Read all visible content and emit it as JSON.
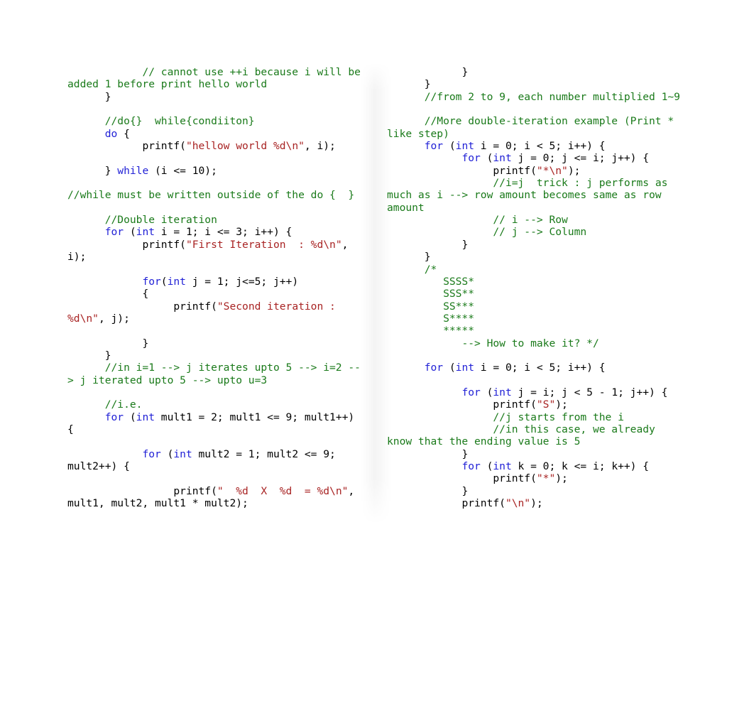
{
  "document": {
    "type": "code-listing",
    "language": "C",
    "layout": "two-column",
    "background_color": "#ffffff",
    "colors": {
      "comment": "#1a7a1a",
      "keyword": "#2121d6",
      "string": "#a82323",
      "plain": "#000000"
    }
  },
  "columns": {
    "left": {
      "lines": [
        [
          {
            "t": "comment",
            "s": "            // cannot use ++i because i will be added 1 before print hello world"
          }
        ],
        [
          {
            "t": "plain",
            "s": "      }"
          }
        ],
        [
          {
            "t": "plain",
            "s": ""
          }
        ],
        [
          {
            "t": "comment",
            "s": "      //do{}  while{condiiton}"
          }
        ],
        [
          {
            "t": "plain",
            "s": "      "
          },
          {
            "t": "keyword",
            "s": "do"
          },
          {
            "t": "plain",
            "s": " {"
          }
        ],
        [
          {
            "t": "plain",
            "s": "            printf("
          },
          {
            "t": "string",
            "s": "\"hellow world %d\\n\""
          },
          {
            "t": "plain",
            "s": ", i);"
          }
        ],
        [
          {
            "t": "plain",
            "s": ""
          }
        ],
        [
          {
            "t": "plain",
            "s": "      } "
          },
          {
            "t": "keyword",
            "s": "while"
          },
          {
            "t": "plain",
            "s": " (i <= 10);"
          }
        ],
        [
          {
            "t": "plain",
            "s": ""
          }
        ],
        [
          {
            "t": "comment",
            "s": "//while must be written outside of the do {  }"
          }
        ],
        [
          {
            "t": "plain",
            "s": ""
          }
        ],
        [
          {
            "t": "comment",
            "s": "      //Double iteration"
          }
        ],
        [
          {
            "t": "plain",
            "s": "      "
          },
          {
            "t": "keyword",
            "s": "for"
          },
          {
            "t": "plain",
            "s": " ("
          },
          {
            "t": "keyword",
            "s": "int"
          },
          {
            "t": "plain",
            "s": " i = 1; i <= 3; i++) {"
          }
        ],
        [
          {
            "t": "plain",
            "s": "            printf("
          },
          {
            "t": "string",
            "s": "\"First Iteration  : %d\\n\""
          },
          {
            "t": "plain",
            "s": ", i);"
          }
        ],
        [
          {
            "t": "plain",
            "s": ""
          }
        ],
        [
          {
            "t": "plain",
            "s": "            "
          },
          {
            "t": "keyword",
            "s": "for"
          },
          {
            "t": "plain",
            "s": "("
          },
          {
            "t": "keyword",
            "s": "int"
          },
          {
            "t": "plain",
            "s": " j = 1; j<=5; j++)"
          }
        ],
        [
          {
            "t": "plain",
            "s": "            {"
          }
        ],
        [
          {
            "t": "plain",
            "s": "                 printf("
          },
          {
            "t": "string",
            "s": "\"Second iteration : %d\\n\""
          },
          {
            "t": "plain",
            "s": ", j);"
          }
        ],
        [
          {
            "t": "plain",
            "s": ""
          }
        ],
        [
          {
            "t": "plain",
            "s": "            }"
          }
        ],
        [
          {
            "t": "plain",
            "s": "      }"
          }
        ],
        [
          {
            "t": "comment",
            "s": "      //in i=1 --> j iterates upto 5 --> i=2 --> j iterated upto 5 --> upto u=3"
          }
        ],
        [
          {
            "t": "plain",
            "s": ""
          }
        ],
        [
          {
            "t": "comment",
            "s": "      //i.e."
          }
        ],
        [
          {
            "t": "plain",
            "s": "      "
          },
          {
            "t": "keyword",
            "s": "for"
          },
          {
            "t": "plain",
            "s": " ("
          },
          {
            "t": "keyword",
            "s": "int"
          },
          {
            "t": "plain",
            "s": " mult1 = 2; mult1 <= 9; mult1++) {"
          }
        ],
        [
          {
            "t": "plain",
            "s": ""
          }
        ],
        [
          {
            "t": "plain",
            "s": "            "
          },
          {
            "t": "keyword",
            "s": "for"
          },
          {
            "t": "plain",
            "s": " ("
          },
          {
            "t": "keyword",
            "s": "int"
          },
          {
            "t": "plain",
            "s": " mult2 = 1; mult2 <= 9; mult2++) {"
          }
        ],
        [
          {
            "t": "plain",
            "s": ""
          }
        ],
        [
          {
            "t": "plain",
            "s": "                 printf("
          },
          {
            "t": "string",
            "s": "\"  %d  X  %d  = %d\\n\""
          },
          {
            "t": "plain",
            "s": ", mult1, mult2, mult1 * mult2);"
          }
        ]
      ]
    },
    "right": {
      "lines": [
        [
          {
            "t": "plain",
            "s": "            }"
          }
        ],
        [
          {
            "t": "plain",
            "s": "      }"
          }
        ],
        [
          {
            "t": "comment",
            "s": "      //from 2 to 9, each number multiplied 1~9"
          }
        ],
        [
          {
            "t": "plain",
            "s": ""
          }
        ],
        [
          {
            "t": "comment",
            "s": "      //More double-iteration example (Print * like step)"
          }
        ],
        [
          {
            "t": "plain",
            "s": "      "
          },
          {
            "t": "keyword",
            "s": "for"
          },
          {
            "t": "plain",
            "s": " ("
          },
          {
            "t": "keyword",
            "s": "int"
          },
          {
            "t": "plain",
            "s": " i = 0; i < 5; i++) {"
          }
        ],
        [
          {
            "t": "plain",
            "s": "            "
          },
          {
            "t": "keyword",
            "s": "for"
          },
          {
            "t": "plain",
            "s": " ("
          },
          {
            "t": "keyword",
            "s": "int"
          },
          {
            "t": "plain",
            "s": " j = 0; j <= i; j++) {"
          }
        ],
        [
          {
            "t": "plain",
            "s": "                 printf("
          },
          {
            "t": "string",
            "s": "\"*\\n\""
          },
          {
            "t": "plain",
            "s": ");"
          }
        ],
        [
          {
            "t": "comment",
            "s": "                 //i=j  trick : j performs as much as i --> row amount becomes same as row amount"
          }
        ],
        [
          {
            "t": "comment",
            "s": "                 // i --> Row"
          }
        ],
        [
          {
            "t": "comment",
            "s": "                 // j --> Column"
          }
        ],
        [
          {
            "t": "plain",
            "s": "            }"
          }
        ],
        [
          {
            "t": "plain",
            "s": "      }"
          }
        ],
        [
          {
            "t": "comment",
            "s": "      /*"
          }
        ],
        [
          {
            "t": "comment",
            "s": "         SSSS*"
          }
        ],
        [
          {
            "t": "comment",
            "s": "         SSS**"
          }
        ],
        [
          {
            "t": "comment",
            "s": "         SS***"
          }
        ],
        [
          {
            "t": "comment",
            "s": "         S****"
          }
        ],
        [
          {
            "t": "comment",
            "s": "         *****"
          }
        ],
        [
          {
            "t": "comment",
            "s": "            --> How to make it? */"
          }
        ],
        [
          {
            "t": "plain",
            "s": ""
          }
        ],
        [
          {
            "t": "plain",
            "s": "      "
          },
          {
            "t": "keyword",
            "s": "for"
          },
          {
            "t": "plain",
            "s": " ("
          },
          {
            "t": "keyword",
            "s": "int"
          },
          {
            "t": "plain",
            "s": " i = 0; i < 5; i++) {"
          }
        ],
        [
          {
            "t": "plain",
            "s": ""
          }
        ],
        [
          {
            "t": "plain",
            "s": "            "
          },
          {
            "t": "keyword",
            "s": "for"
          },
          {
            "t": "plain",
            "s": " ("
          },
          {
            "t": "keyword",
            "s": "int"
          },
          {
            "t": "plain",
            "s": " j = i; j < 5 - 1; j++) {"
          }
        ],
        [
          {
            "t": "plain",
            "s": "                 printf("
          },
          {
            "t": "string",
            "s": "\"S\""
          },
          {
            "t": "plain",
            "s": ");"
          }
        ],
        [
          {
            "t": "comment",
            "s": "                 //j starts from the i"
          }
        ],
        [
          {
            "t": "comment",
            "s": "                 //in this case, we already know that the ending value is 5"
          }
        ],
        [
          {
            "t": "plain",
            "s": "            }"
          }
        ],
        [
          {
            "t": "plain",
            "s": "            "
          },
          {
            "t": "keyword",
            "s": "for"
          },
          {
            "t": "plain",
            "s": " ("
          },
          {
            "t": "keyword",
            "s": "int"
          },
          {
            "t": "plain",
            "s": " k = 0; k <= i; k++) {"
          }
        ],
        [
          {
            "t": "plain",
            "s": "                 printf("
          },
          {
            "t": "string",
            "s": "\"*\""
          },
          {
            "t": "plain",
            "s": ");"
          }
        ],
        [
          {
            "t": "plain",
            "s": "            }"
          }
        ],
        [
          {
            "t": "plain",
            "s": "            printf("
          },
          {
            "t": "string",
            "s": "\"\\n\""
          },
          {
            "t": "plain",
            "s": ");"
          }
        ]
      ]
    }
  }
}
